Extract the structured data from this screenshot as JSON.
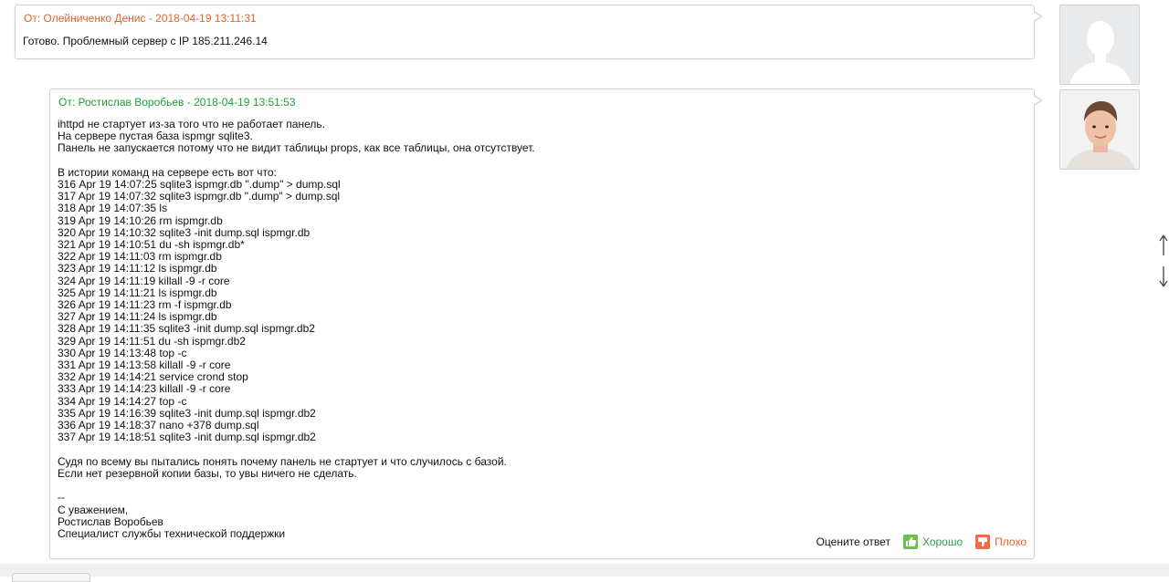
{
  "messages": [
    {
      "header": "От: Олейниченко Денис - 2018-04-19 13:11:31",
      "body": "Готово. Проблемный сервер с IP 185.211.246.14",
      "author_color": "#e0622a"
    },
    {
      "header": "От: Ростислав Воробьев - 2018-04-19 13:51:53",
      "body": "ihttpd не стартует из-за того что не работает панель.\nНа сервере пустая база ispmgr sqlite3.\nПанель не запускается потому что не видит таблицы props, как все таблицы, она отсутствует.\n\nВ истории команд на сервере есть вот что:\n316 Apr 19 14:07:25 sqlite3 ispmgr.db \".dump\" > dump.sql\n317 Apr 19 14:07:32 sqlite3 ispmgr.db \".dump\" > dump.sql\n318 Apr 19 14:07:35 ls\n319 Apr 19 14:10:26 rm ispmgr.db\n320 Apr 19 14:10:32 sqlite3 -init dump.sql ispmgr.db\n321 Apr 19 14:10:51 du -sh ispmgr.db*\n322 Apr 19 14:11:03 rm ispmgr.db\n323 Apr 19 14:11:12 ls ispmgr.db\n324 Apr 19 14:11:19 killall -9 -r core\n325 Apr 19 14:11:21 ls ispmgr.db\n326 Apr 19 14:11:23 rm -f ispmgr.db\n327 Apr 19 14:11:24 ls ispmgr.db\n328 Apr 19 14:11:35 sqlite3 -init dump.sql ispmgr.db2\n329 Apr 19 14:11:51 du -sh ispmgr.db2\n330 Apr 19 14:13:48 top -c\n331 Apr 19 14:13:58 killall -9 -r core\n332 Apr 19 14:14:21 service crond stop\n333 Apr 19 14:14:23 killall -9 -r core\n334 Apr 19 14:14:27 top -c\n335 Apr 19 14:16:39 sqlite3 -init dump.sql ispmgr.db2\n336 Apr 19 14:18:37 nano +378 dump.sql\n337 Apr 19 14:18:51 sqlite3 -init dump.sql ispmgr.db2\n\nСудя по всему вы пытались понять почему панель не стартует и что случилось с базой.\nЕсли нет резервной копии базы, то увы ничего не сделать.\n\n--\nС уважением,\nРостислав Воробьев\nСпециалист службы технической поддержки",
      "author_color": "#1f9c3e"
    }
  ],
  "rating": {
    "label": "Оцените ответ",
    "good_label": "Хорошо",
    "bad_label": "Плохо",
    "good_color": "#2e9e48",
    "bad_color": "#e0622a"
  },
  "icons": {
    "avatar_placeholder": "user-silhouette-icon",
    "avatar_photo": "user-photo",
    "thumbs_up": "thumbs-up-icon",
    "thumbs_down": "thumbs-down-icon",
    "scroll": "scroll-arrows-icon"
  }
}
